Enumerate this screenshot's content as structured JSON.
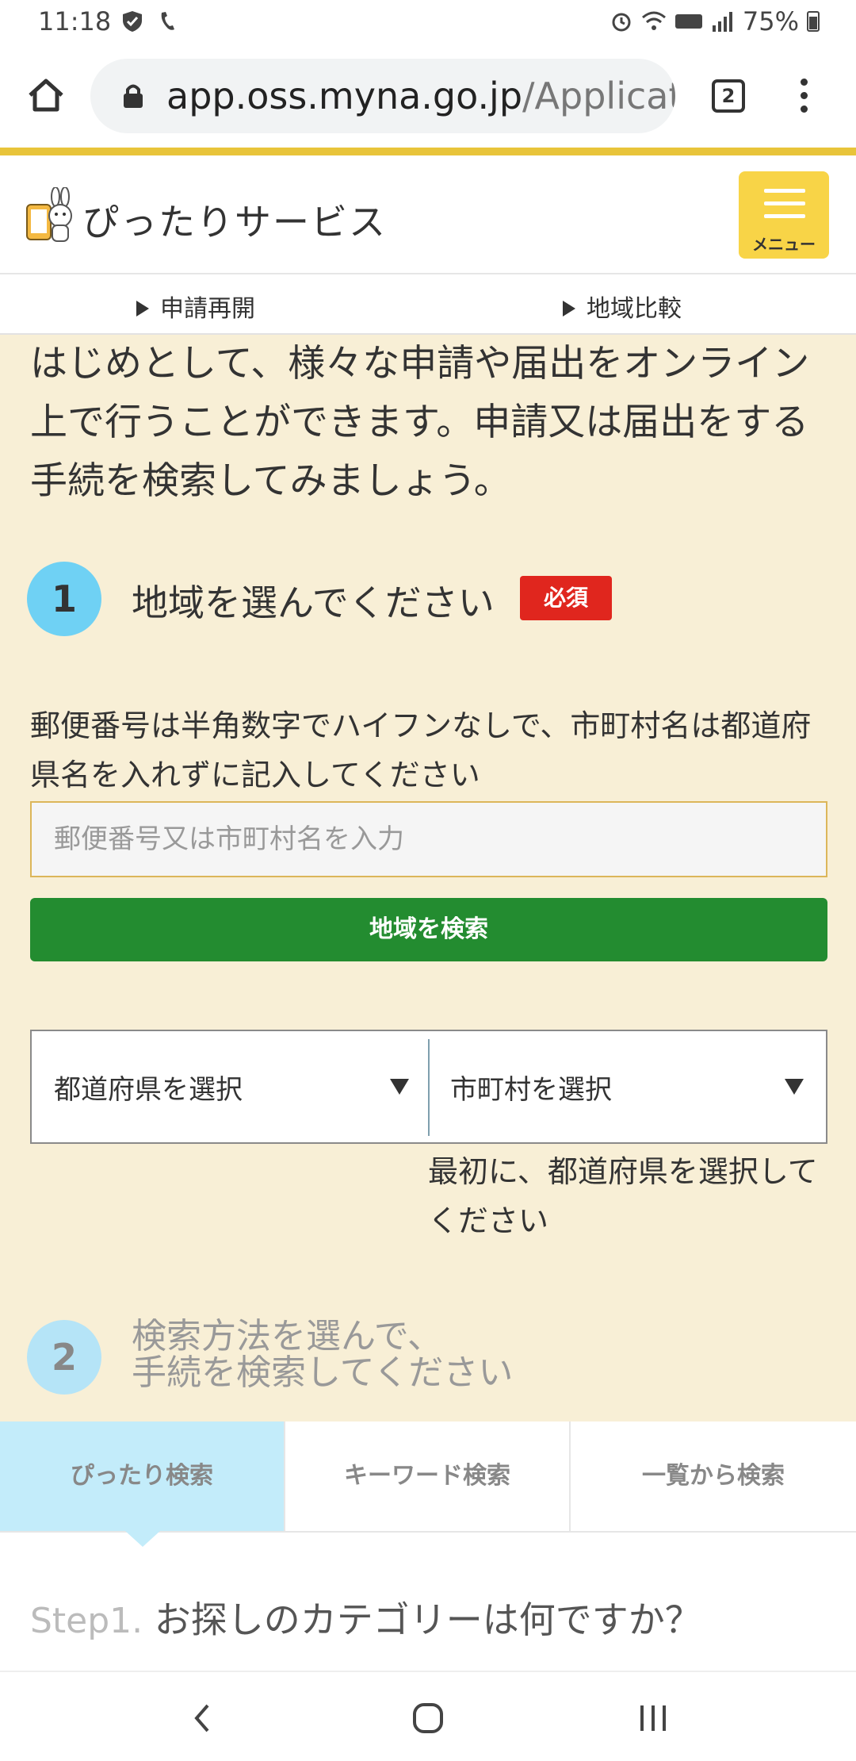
{
  "status_bar": {
    "time": "11:18",
    "battery": "75%"
  },
  "browser": {
    "url_host": "app.oss.myna.go.jp",
    "url_path": "/Applicat",
    "tab_count": "2"
  },
  "site": {
    "title": "ぴったりサービス",
    "menu_label": "メニュー",
    "accent_color": "#e8c43a"
  },
  "subnav": {
    "items": [
      {
        "label": "申請再開"
      },
      {
        "label": "地域比較"
      }
    ]
  },
  "intro": {
    "text": "はじめとして、様々な申請や届出をオンライン上で行うことができます。申請又は届出をする手続を検索してみましょう。"
  },
  "step1": {
    "number": "1",
    "title": "地域を選んでください",
    "required_badge": "必須",
    "hint": "郵便番号は半角数字でハイフンなしで、市町村名は都道府県名を入れずに記入してください",
    "input_placeholder": "郵便番号又は市町村名を入力",
    "input_value": "",
    "search_button": "地域を検索",
    "prefecture_select": "都道府県を選択",
    "city_select": "市町村を選択",
    "select_note": "最初に、都道府県を選択してください"
  },
  "step2": {
    "number": "2",
    "title_line1": "検索方法を選んで、",
    "title_line2": "手続を検索してください"
  },
  "method_tabs": [
    {
      "label": "ぴったり検索",
      "active": true
    },
    {
      "label": "キーワード検索",
      "active": false
    },
    {
      "label": "一覧から検索",
      "active": false
    }
  ],
  "step_question": {
    "label": "Step1.",
    "text": "お探しのカテゴリーは何ですか？"
  }
}
